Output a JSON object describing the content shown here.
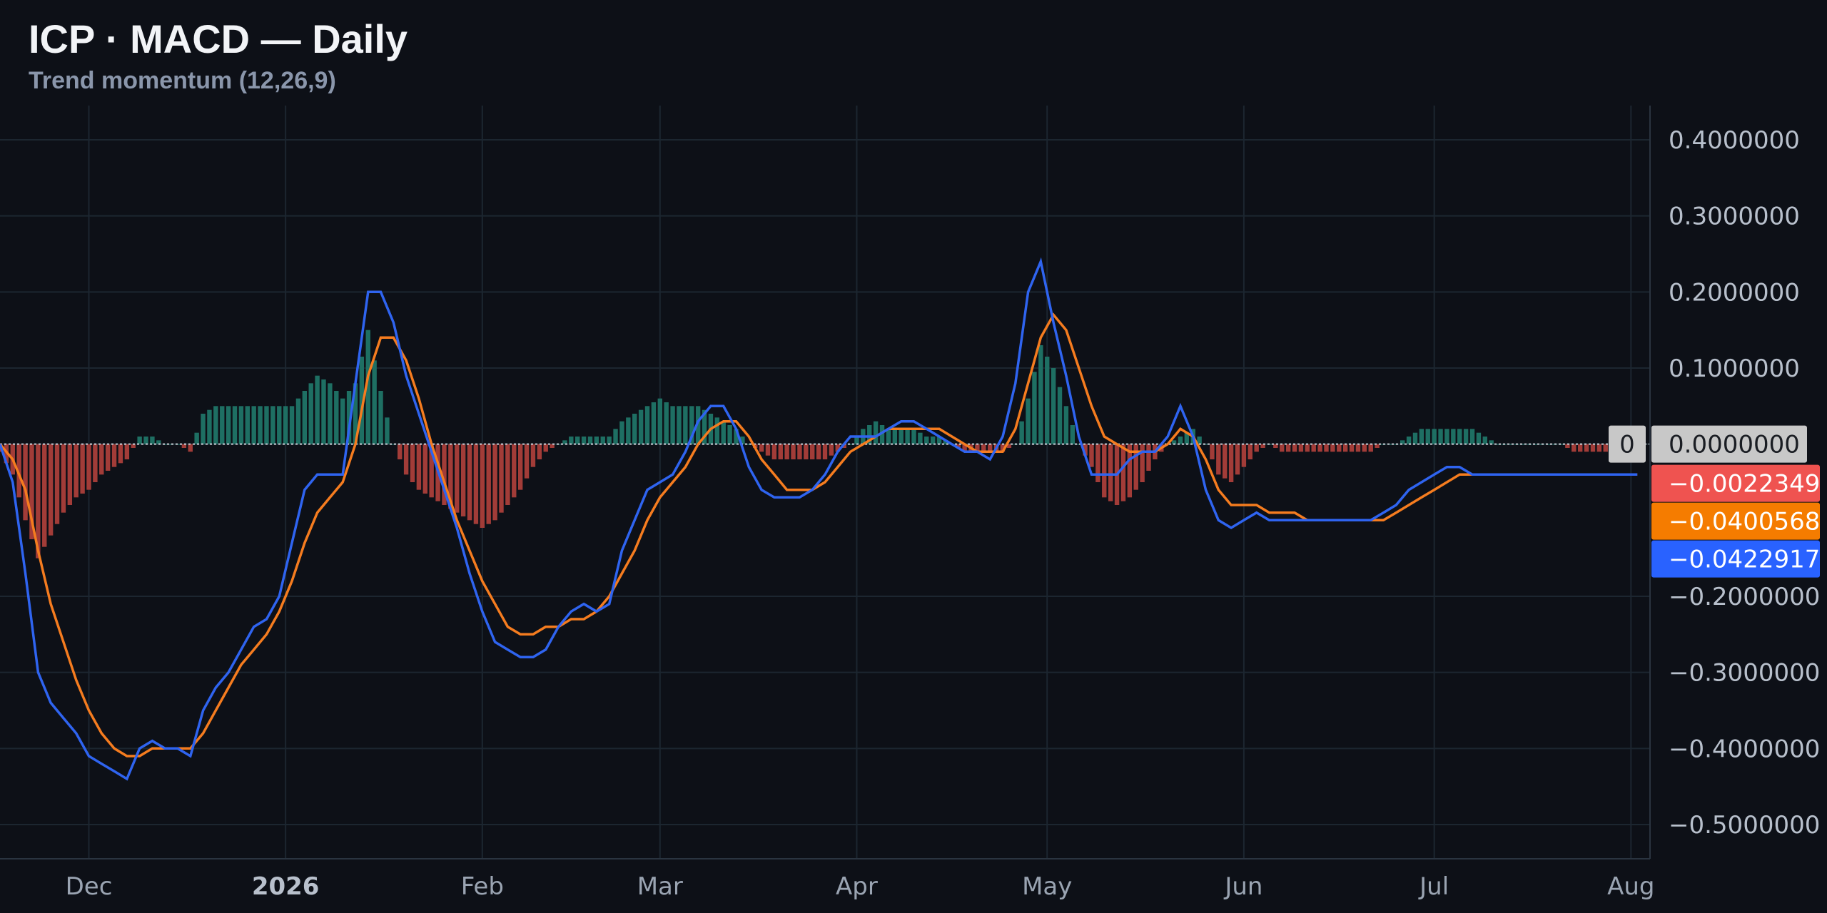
{
  "chart_data": {
    "type": "line",
    "title": "ICP · MACD — Daily",
    "subtitle": "Trend momentum (12,26,9)",
    "x_ticks": [
      "Dec",
      "2026",
      "Feb",
      "Mar",
      "Apr",
      "May",
      "Jun",
      "Jul",
      "Aug"
    ],
    "x_tick_positions": [
      16,
      47,
      78,
      106,
      137,
      167,
      198,
      228,
      259
    ],
    "x_range": [
      2,
      262
    ],
    "ylim": [
      -0.545,
      0.445
    ],
    "y_ticks": [
      0.4,
      0.3,
      0.2,
      0.1,
      0.0,
      -0.2,
      -0.3,
      -0.4,
      -0.5
    ],
    "y_tick_labels": [
      "0.4000000",
      "0.3000000",
      "0.2000000",
      "0.1000000",
      "0.0000000",
      "−0.2000000",
      "−0.3000000",
      "−0.4000000",
      "−0.5000000"
    ],
    "grid": true,
    "zero_badge": "0",
    "series": [
      {
        "role": "macd",
        "color": "#2f64f0",
        "x": [
          2,
          4,
          6,
          8,
          10,
          12,
          14,
          16,
          18,
          20,
          22,
          24,
          26,
          28,
          30,
          32,
          34,
          36,
          38,
          40,
          42,
          44,
          46,
          48,
          50,
          52,
          54,
          56,
          58,
          60,
          62,
          64,
          66,
          68,
          70,
          72,
          74,
          76,
          78,
          80,
          82,
          84,
          86,
          88,
          90,
          92,
          94,
          96,
          98,
          100,
          102,
          104,
          106,
          108,
          110,
          112,
          114,
          116,
          118,
          120,
          122,
          124,
          126,
          128,
          130,
          132,
          134,
          136,
          138,
          140,
          142,
          144,
          146,
          148,
          150,
          152,
          154,
          156,
          158,
          160,
          162,
          164,
          166,
          168,
          170,
          172,
          174,
          176,
          178,
          180,
          182,
          184,
          186,
          188,
          190,
          192,
          194,
          196,
          198,
          200,
          202,
          204,
          206,
          208,
          210,
          212,
          214,
          216,
          218,
          220,
          222,
          224,
          226,
          228,
          230,
          232,
          234,
          236,
          238,
          240,
          242,
          244,
          246,
          248,
          250,
          252,
          254,
          256,
          258,
          260
        ],
        "y": [
          0.0,
          -0.05,
          -0.17,
          -0.3,
          -0.34,
          -0.36,
          -0.38,
          -0.41,
          -0.42,
          -0.43,
          -0.44,
          -0.4,
          -0.39,
          -0.4,
          -0.4,
          -0.41,
          -0.35,
          -0.32,
          -0.3,
          -0.27,
          -0.24,
          -0.23,
          -0.2,
          -0.13,
          -0.06,
          -0.04,
          -0.04,
          -0.04,
          0.08,
          0.2,
          0.2,
          0.16,
          0.09,
          0.04,
          -0.01,
          -0.06,
          -0.11,
          -0.17,
          -0.22,
          -0.26,
          -0.27,
          -0.28,
          -0.28,
          -0.27,
          -0.24,
          -0.22,
          -0.21,
          -0.22,
          -0.21,
          -0.14,
          -0.1,
          -0.06,
          -0.05,
          -0.04,
          -0.01,
          0.03,
          0.05,
          0.05,
          0.02,
          -0.03,
          -0.06,
          -0.07,
          -0.07,
          -0.07,
          -0.06,
          -0.04,
          -0.01,
          0.01,
          0.01,
          0.01,
          0.02,
          0.03,
          0.03,
          0.02,
          0.01,
          0.0,
          -0.01,
          -0.01,
          -0.02,
          0.01,
          0.08,
          0.2,
          0.24,
          0.16,
          0.09,
          0.01,
          -0.04,
          -0.04,
          -0.04,
          -0.02,
          -0.01,
          -0.01,
          0.01,
          0.05,
          0.01,
          -0.06,
          -0.1,
          -0.11,
          -0.1,
          -0.09,
          -0.1,
          -0.1,
          -0.1,
          -0.1,
          -0.1,
          -0.1,
          -0.1,
          -0.1,
          -0.1,
          -0.09,
          -0.08,
          -0.06,
          -0.05,
          -0.04,
          -0.03,
          -0.03,
          -0.04,
          -0.04,
          -0.04,
          -0.04,
          -0.04,
          -0.04,
          -0.04,
          -0.04,
          -0.04,
          -0.04,
          -0.04,
          -0.04,
          -0.04,
          -0.04
        ]
      },
      {
        "role": "signal",
        "color": "#f57c1f",
        "x": [
          2,
          4,
          6,
          8,
          10,
          12,
          14,
          16,
          18,
          20,
          22,
          24,
          26,
          28,
          30,
          32,
          34,
          36,
          38,
          40,
          42,
          44,
          46,
          48,
          50,
          52,
          54,
          56,
          58,
          60,
          62,
          64,
          66,
          68,
          70,
          72,
          74,
          76,
          78,
          80,
          82,
          84,
          86,
          88,
          90,
          92,
          94,
          96,
          98,
          100,
          102,
          104,
          106,
          108,
          110,
          112,
          114,
          116,
          118,
          120,
          122,
          124,
          126,
          128,
          130,
          132,
          134,
          136,
          138,
          140,
          142,
          144,
          146,
          148,
          150,
          152,
          154,
          156,
          158,
          160,
          162,
          164,
          166,
          168,
          170,
          172,
          174,
          176,
          178,
          180,
          182,
          184,
          186,
          188,
          190,
          192,
          194,
          196,
          198,
          200,
          202,
          204,
          206,
          208,
          210,
          212,
          214,
          216,
          218,
          220,
          222,
          224,
          226,
          228,
          230,
          232,
          234,
          236,
          238,
          240,
          242,
          244,
          246,
          248,
          250,
          252,
          254,
          256,
          258,
          260
        ],
        "y": [
          0.0,
          -0.02,
          -0.06,
          -0.14,
          -0.21,
          -0.26,
          -0.31,
          -0.35,
          -0.38,
          -0.4,
          -0.41,
          -0.41,
          -0.4,
          -0.4,
          -0.4,
          -0.4,
          -0.38,
          -0.35,
          -0.32,
          -0.29,
          -0.27,
          -0.25,
          -0.22,
          -0.18,
          -0.13,
          -0.09,
          -0.07,
          -0.05,
          0.0,
          0.09,
          0.14,
          0.14,
          0.11,
          0.06,
          0.0,
          -0.05,
          -0.1,
          -0.14,
          -0.18,
          -0.21,
          -0.24,
          -0.25,
          -0.25,
          -0.24,
          -0.24,
          -0.23,
          -0.23,
          -0.22,
          -0.2,
          -0.17,
          -0.14,
          -0.1,
          -0.07,
          -0.05,
          -0.03,
          0.0,
          0.02,
          0.03,
          0.03,
          0.01,
          -0.02,
          -0.04,
          -0.06,
          -0.06,
          -0.06,
          -0.05,
          -0.03,
          -0.01,
          0.0,
          0.01,
          0.02,
          0.02,
          0.02,
          0.02,
          0.02,
          0.01,
          0.0,
          -0.01,
          -0.01,
          -0.01,
          0.02,
          0.08,
          0.14,
          0.17,
          0.15,
          0.1,
          0.05,
          0.01,
          0.0,
          -0.01,
          -0.01,
          -0.01,
          0.0,
          0.02,
          0.01,
          -0.02,
          -0.06,
          -0.08,
          -0.08,
          -0.08,
          -0.09,
          -0.09,
          -0.09,
          -0.1,
          -0.1,
          -0.1,
          -0.1,
          -0.1,
          -0.1,
          -0.1,
          -0.09,
          -0.08,
          -0.07,
          -0.06,
          -0.05,
          -0.04,
          -0.04,
          -0.04,
          -0.04,
          -0.04,
          -0.04,
          -0.04,
          -0.04,
          -0.04,
          -0.04,
          -0.04,
          -0.04,
          -0.04,
          -0.04,
          -0.04
        ]
      },
      {
        "role": "histogram",
        "type": "bar",
        "positive_color": "#1e6f63",
        "negative_color": "#a23c38",
        "x": [
          2,
          4,
          6,
          8,
          10,
          12,
          14,
          16,
          18,
          20,
          22,
          24,
          26,
          28,
          30,
          32,
          34,
          36,
          38,
          40,
          42,
          44,
          46,
          48,
          50,
          52,
          54,
          56,
          58,
          60,
          62,
          64,
          66,
          68,
          70,
          72,
          74,
          76,
          78,
          80,
          82,
          84,
          86,
          88,
          90,
          92,
          94,
          96,
          98,
          100,
          102,
          104,
          106,
          108,
          110,
          112,
          114,
          116,
          118,
          120,
          122,
          124,
          126,
          128,
          130,
          132,
          134,
          136,
          138,
          140,
          142,
          144,
          146,
          148,
          150,
          152,
          154,
          156,
          158,
          160,
          162,
          164,
          166,
          168,
          170,
          172,
          174,
          176,
          178,
          180,
          182,
          184,
          186,
          188,
          190,
          192,
          194,
          196,
          198,
          200,
          202,
          204,
          206,
          208,
          210,
          212,
          214,
          216,
          218,
          220,
          222,
          224,
          226,
          228,
          230,
          232,
          234,
          236,
          238,
          240,
          242,
          244,
          246,
          248,
          250,
          252,
          254,
          256,
          258,
          260
        ],
        "y": [
          -0.01,
          -0.04,
          -0.1,
          -0.15,
          -0.12,
          -0.09,
          -0.07,
          -0.06,
          -0.04,
          -0.03,
          -0.02,
          0.01,
          0.01,
          0.0,
          0.0,
          -0.01,
          0.04,
          0.05,
          0.05,
          0.05,
          0.05,
          0.05,
          0.05,
          0.05,
          0.07,
          0.09,
          0.08,
          0.06,
          0.08,
          0.15,
          0.07,
          0.0,
          -0.04,
          -0.06,
          -0.07,
          -0.08,
          -0.09,
          -0.1,
          -0.11,
          -0.1,
          -0.08,
          -0.06,
          -0.03,
          -0.01,
          0.0,
          0.01,
          0.01,
          0.01,
          0.01,
          0.03,
          0.04,
          0.05,
          0.06,
          0.05,
          0.05,
          0.05,
          0.04,
          0.03,
          0.02,
          0.0,
          -0.01,
          -0.02,
          -0.02,
          -0.02,
          -0.02,
          -0.02,
          -0.01,
          0.0,
          0.02,
          0.03,
          0.02,
          0.02,
          0.02,
          0.01,
          0.01,
          0.0,
          -0.01,
          -0.01,
          -0.01,
          -0.01,
          0.0,
          0.06,
          0.13,
          0.1,
          0.05,
          0.0,
          -0.03,
          -0.07,
          -0.08,
          -0.07,
          -0.05,
          -0.02,
          0.0,
          0.01,
          0.02,
          0.0,
          -0.04,
          -0.05,
          -0.03,
          -0.01,
          0.0,
          -0.01,
          -0.01,
          -0.01,
          -0.01,
          -0.01,
          -0.01,
          -0.01,
          -0.01,
          0.0,
          0.0,
          0.01,
          0.02,
          0.02,
          0.02,
          0.02,
          0.02,
          0.01,
          0.0,
          0.0,
          0.0,
          0.0,
          0.0,
          0.0,
          -0.01,
          -0.01,
          -0.01,
          -0.01,
          -0.01,
          -0.01
        ]
      }
    ],
    "price_tags": [
      {
        "label": "−0.0022349",
        "value": -0.0022349,
        "color": "#ef5350"
      },
      {
        "label": "−0.0400568",
        "value": -0.0400568,
        "color": "#f57c00"
      },
      {
        "label": "−0.0422917",
        "value": -0.0422917,
        "color": "#2962ff"
      }
    ]
  }
}
